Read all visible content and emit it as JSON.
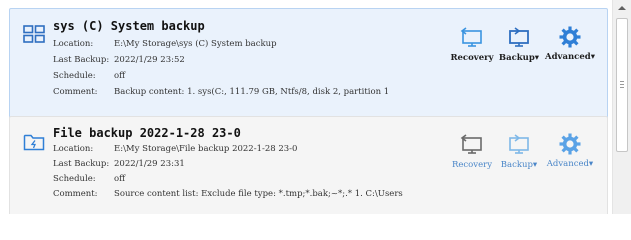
{
  "tasks": [
    {
      "title": "sys (C) System backup",
      "fields": [
        {
          "label": "Location:",
          "value": "E:\\My Storage\\sys (C) System backup"
        },
        {
          "label": "Last Backup:",
          "value": "2022/1/29 23:52"
        },
        {
          "label": "Schedule:",
          "value": "off"
        },
        {
          "label": "Comment:",
          "value": "Backup content:  1. sys(C:, 111.79 GB, Ntfs/8, disk 2, partition 1"
        }
      ],
      "actions": {
        "recovery": "Recovery",
        "backup": "Backup▾",
        "advanced": "Advanced▾"
      },
      "icon": "system-backup-icon"
    },
    {
      "title": "File backup 2022-1-28 23-0",
      "fields": [
        {
          "label": "Location:",
          "value": "E:\\My Storage\\File backup 2022-1-28 23-0"
        },
        {
          "label": "Last Backup:",
          "value": "2022/1/29 23:31"
        },
        {
          "label": "Schedule:",
          "value": "off"
        },
        {
          "label": "Comment:",
          "value": "Source content list:  Exclude file type: *.tmp;*.bak;~*;.*      1. C:\\Users"
        }
      ],
      "actions": {
        "recovery": "Recovery",
        "backup": "Backup▾",
        "advanced": "Advanced▾"
      },
      "icon": "file-backup-icon"
    }
  ],
  "colors": {
    "selected_bg": "#eaf2fc",
    "accent": "#2f7fd6",
    "link": "#4a86c8"
  }
}
